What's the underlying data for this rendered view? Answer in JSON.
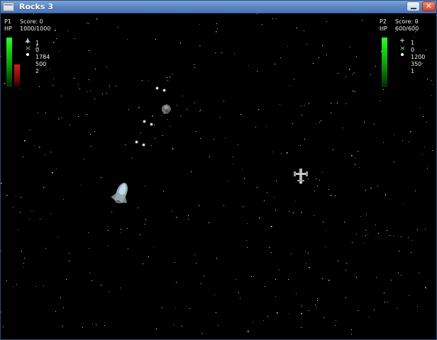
{
  "window": {
    "title": "Rocks 3",
    "close_glyph": "✕"
  },
  "player1": {
    "id_label": "P1",
    "score_label": "Score: 0",
    "hp_label": "HP",
    "hp_value": "1000/1000",
    "hp_fraction": 1.0,
    "stats": [
      "1",
      "0",
      "1784",
      "500",
      "2"
    ],
    "bar_colors": {
      "hp": "#1fd21f",
      "secondary": "#c01818"
    }
  },
  "player2": {
    "id_label": "P2",
    "score_label": "Score: 0",
    "hp_label": "HP",
    "hp_value": "600/600",
    "hp_fraction": 1.0,
    "stats": [
      "1",
      "0",
      "1200",
      "350",
      "1"
    ],
    "bar_colors": {
      "hp": "#1fd21f"
    }
  },
  "icons": {
    "ship": "ship-icon",
    "drone": "drone-icon",
    "bullet": "ammo-dot-icon"
  }
}
